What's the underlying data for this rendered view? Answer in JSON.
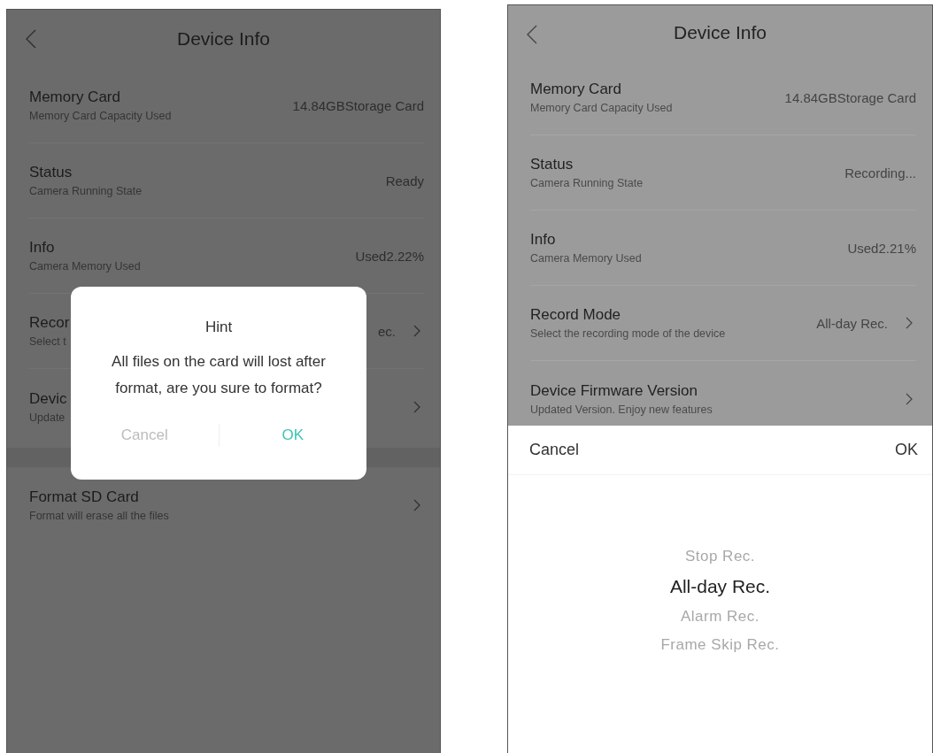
{
  "screens": [
    {
      "title": "Device Info",
      "sections": [
        [
          {
            "title": "Memory Card",
            "subtitle": "Memory Card Capacity Used",
            "value": "14.84GBStorage Card",
            "chevron": false
          },
          {
            "title": "Status",
            "subtitle": "Camera Running State",
            "value": "Ready",
            "chevron": false
          },
          {
            "title": "Info",
            "subtitle": "Camera Memory Used",
            "value": "Used2.22%",
            "chevron": false
          },
          {
            "title": "Recor",
            "subtitle": "Select t",
            "value": "ec.",
            "chevron": true
          },
          {
            "title": "Devic",
            "subtitle": "Update",
            "chevron": true
          }
        ],
        [
          {
            "title": "Format SD Card",
            "subtitle": "Format will erase all the files",
            "chevron": true
          }
        ]
      ],
      "dialog": {
        "title": "Hint",
        "message": "All files on the card will lost after format, are you sure to format?",
        "cancel": "Cancel",
        "ok": "OK"
      }
    },
    {
      "title": "Device Info",
      "sections": [
        [
          {
            "title": "Memory Card",
            "subtitle": "Memory Card Capacity Used",
            "value": "14.84GBStorage Card",
            "chevron": false
          },
          {
            "title": "Status",
            "subtitle": "Camera Running State",
            "value": "Recording...",
            "chevron": false
          },
          {
            "title": "Info",
            "subtitle": "Camera Memory Used",
            "value": "Used2.21%",
            "chevron": false
          },
          {
            "title": "Record Mode",
            "subtitle": "Select the recording mode of the device",
            "value": "All-day Rec.",
            "chevron": true
          },
          {
            "title": "Device Firmware Version",
            "subtitle": "Updated Version. Enjoy new features",
            "chevron": true
          }
        ]
      ],
      "picker": {
        "cancel": "Cancel",
        "ok": "OK",
        "options": [
          {
            "label": "Stop Rec.",
            "selected": false
          },
          {
            "label": "All-day Rec.",
            "selected": true
          },
          {
            "label": "Alarm Rec.",
            "selected": false
          },
          {
            "label": "Frame Skip Rec.",
            "selected": false
          }
        ]
      }
    }
  ]
}
